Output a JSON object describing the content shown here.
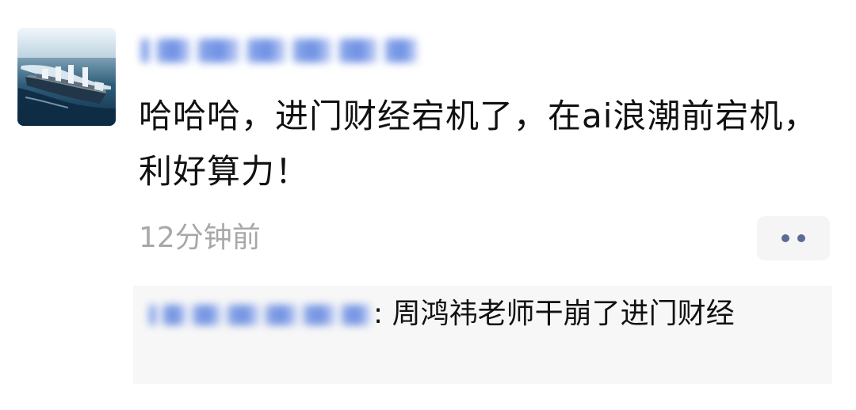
{
  "post": {
    "author_name": "",
    "text": "哈哈哈，进门财经宕机了，在ai浪潮前宕机，利好算力！",
    "timestamp": "12分钟前"
  },
  "actions": {
    "more_icon": "more-dots-icon"
  },
  "comment": {
    "author_name": "",
    "separator": ":",
    "text": "周鸿祎老师干崩了进门财经"
  },
  "colors": {
    "timestamp_text": "#a8a8a8",
    "link_blue": "#6c8fe4",
    "comment_background": "#f7f7f7",
    "more_button_background": "#f5f5f5",
    "more_dots": "#5b6b97"
  },
  "icons": {
    "avatar": "ship-avatar-icon"
  }
}
